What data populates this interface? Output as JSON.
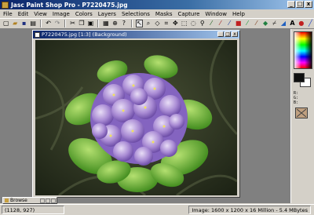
{
  "app": {
    "title": "Jasc Paint Shop Pro - P7220475.jpg",
    "window_buttons": [
      "_",
      "□",
      "x"
    ]
  },
  "menu": [
    "File",
    "Edit",
    "View",
    "Image",
    "Colors",
    "Layers",
    "Selections",
    "Masks",
    "Capture",
    "Window",
    "Help"
  ],
  "toolbar": {
    "icons": [
      "new-icon",
      "open-icon",
      "save-icon",
      "print-icon",
      "undo-icon",
      "redo-icon",
      "cut-icon",
      "copy-icon",
      "paste-icon",
      "browse-icon",
      "zoom-icon",
      "help-icon",
      "arrow-tool-icon",
      "zoom-tool-icon",
      "deform-tool-icon",
      "crop-tool-icon",
      "mover-tool-icon",
      "selection-tool-icon",
      "freehand-tool-icon",
      "magic-wand-icon",
      "dropper-icon",
      "paintbrush-icon",
      "clone-brush-icon",
      "color-replacer-icon",
      "retouch-icon",
      "eraser-icon",
      "picture-tube-icon",
      "airbrush-icon",
      "flood-fill-icon",
      "text-tool-icon",
      "shapes-tool-icon",
      "draw-tool-icon"
    ]
  },
  "image_window": {
    "title": "P7220475.jpg [1:3] (Background)"
  },
  "palette": {
    "info_lines": [
      "R:",
      "G:",
      "B:"
    ]
  },
  "browse": {
    "label": "Browse"
  },
  "status": {
    "coords": "(1128, 927)",
    "image_info": "Image: 1600 x 1200 x 16 Million - 5.4 MBytes"
  }
}
